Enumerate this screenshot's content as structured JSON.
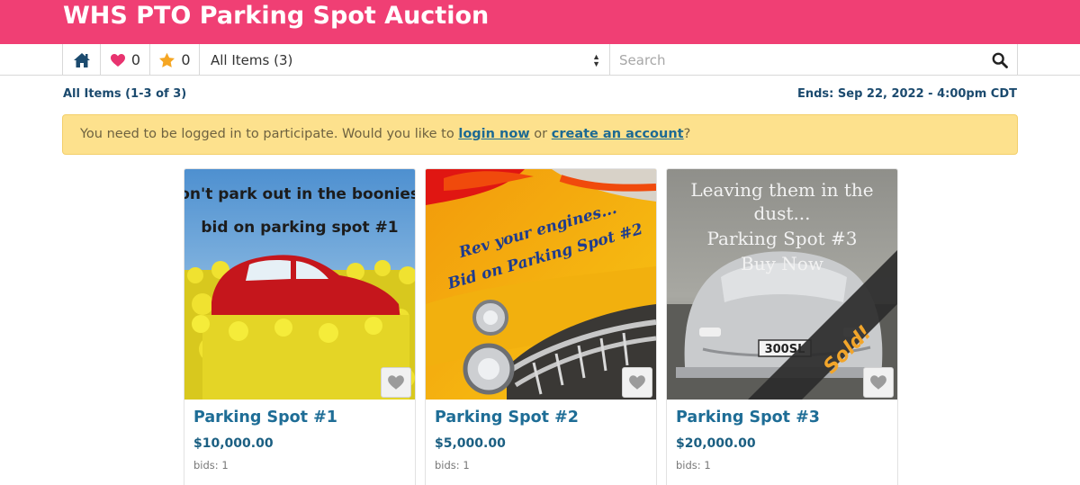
{
  "header": {
    "title": "WHS PTO Parking Spot Auction"
  },
  "toolbar": {
    "favorites_count": "0",
    "watch_count": "0",
    "category_select": "All Items (3)",
    "search_placeholder": "Search"
  },
  "subbar": {
    "items_label": "All Items (1-3 of 3)",
    "ends_label": "Ends: Sep 22, 2022 - 4:00pm CDT"
  },
  "alert": {
    "prefix": "You need to be logged in to participate. Would you like to ",
    "login_link": "login now",
    "middle": " or ",
    "create_link": "create an account",
    "suffix": "?"
  },
  "items": [
    {
      "title": "Parking Spot #1",
      "price": "$10,000.00",
      "bids": "bids: 1",
      "image_text": [
        "don't park out in the boonies -",
        "bid on parking spot #1"
      ]
    },
    {
      "title": "Parking Spot #2",
      "price": "$5,000.00",
      "bids": "bids: 1",
      "image_text": [
        "Rev your engines...",
        "Bid on Parking Spot #2"
      ]
    },
    {
      "title": "Parking Spot #3",
      "price": "$20,000.00",
      "bids": "bids: 1",
      "image_text": [
        "Leaving them in the",
        "dust...",
        "Parking Spot #3",
        "Buy Now"
      ],
      "ribbon": "Sold!",
      "plate": "300SL"
    }
  ],
  "colors": {
    "brand_pink": "#f03f74",
    "link_blue": "#1e6d96",
    "alert_bg": "#fde18d",
    "heart_pink": "#e8336f",
    "star_orange": "#f5a623"
  },
  "icons": [
    "home-icon",
    "heart-icon",
    "star-icon",
    "select-arrows-icon",
    "search-icon",
    "favorite-heart-icon"
  ]
}
